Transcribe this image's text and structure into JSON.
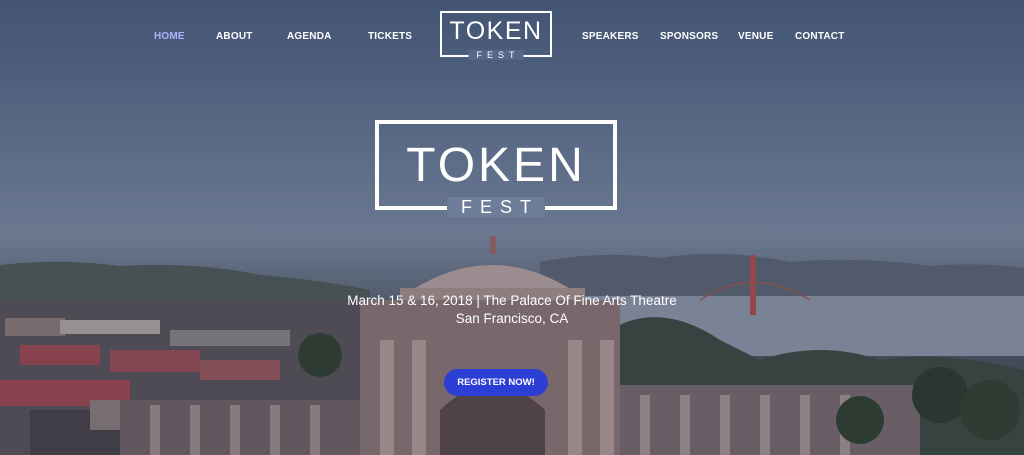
{
  "nav": {
    "left_items": [
      "HOME",
      "ABOUT",
      "AGENDA",
      "TICKETS"
    ],
    "right_items": [
      "SPEAKERS",
      "SPONSORS",
      "VENUE",
      "CONTACT"
    ],
    "active": "HOME",
    "logo_word": "TOKEN",
    "logo_sub": "FEST"
  },
  "hero": {
    "logo_word": "TOKEN",
    "logo_sub": "FEST",
    "date_line": "March 15 & 16, 2018 | The Palace Of Fine Arts Theatre",
    "place_line": "San Francisco, CA",
    "cta_label": "REGISTER NOW!"
  },
  "colors": {
    "accent_button": "#2d3ed6",
    "active_nav": "#aab4ff",
    "text": "#ffffff"
  }
}
